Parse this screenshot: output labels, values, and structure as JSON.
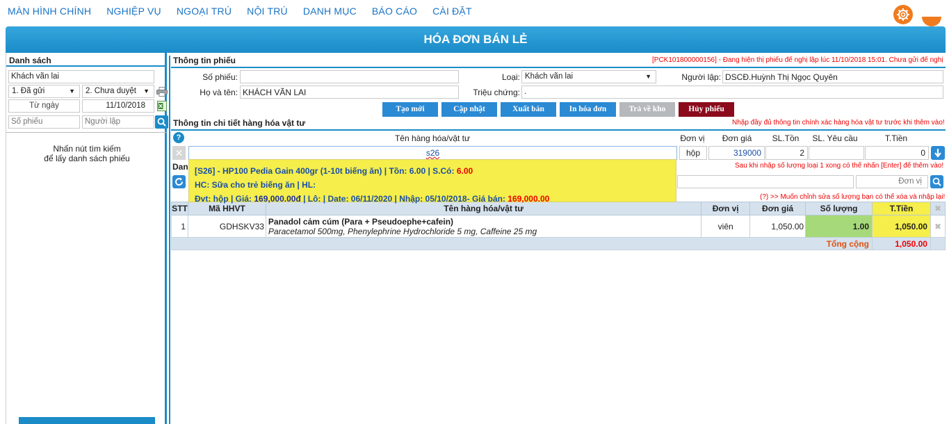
{
  "nav": {
    "items": [
      "MÀN HÌNH CHÍNH",
      "NGHIỆP VỤ",
      "NGOẠI TRÚ",
      "NỘI TRÚ",
      "DANH MỤC",
      "BÁO CÁO",
      "CÀI ĐẶT"
    ],
    "settings_icon": "gear-icon"
  },
  "page_title": "HÓA ĐƠN BÁN LẺ",
  "list_panel": {
    "title": "Danh sách",
    "customer": "Khách vãn lai",
    "status_sent": "1. Đã gửi",
    "status_approval": "2. Chưa duyệt",
    "from_date_label": "Từ ngày",
    "from_date": "11/10/2018",
    "receipt_no_placeholder": "Số phiếu",
    "creator_placeholder": "Người lập",
    "hint_line1": "Nhấn nút tìm kiếm",
    "hint_line2": "để lấy danh sách phiếu"
  },
  "receipt_info": {
    "title": "Thông tin phiếu",
    "status_note": "[PCK101800000156] - Đang hiện thị phiếu để nghị lập lúc 11/10/2018 15:01. Chưa gửi để nghị",
    "receipt_no_label": "Số phiếu:",
    "receipt_no": "",
    "type_label": "Loại:",
    "type": "Khách vãn lai",
    "creator_label": "Người lập:",
    "creator": "DSCĐ.Huỳnh Thị Ngọc Quyên",
    "fullname_label": "Họ và tên:",
    "fullname": "KHÁCH VÃN LAI",
    "symptoms_label": "Triệu chứng:",
    "symptoms": "."
  },
  "actions": {
    "create": "Tạo mới",
    "update": "Cập nhật",
    "sell": "Xuất bán",
    "print": "In hóa đơn",
    "return": "Trả về kho",
    "cancel": "Hủy phiếu"
  },
  "detail": {
    "title": "Thông tin chi tiết hàng hóa vật tư",
    "note": "Nhập đầy đủ thông tin chính xác hàng hóa vật tư trước khi thêm vào!",
    "col_name": "Tên hàng hóa/vật tư",
    "col_unit": "Đơn vị",
    "col_price": "Đơn giá",
    "col_stock": "SL.Tồn",
    "col_request": "SL. Yêu cầu",
    "col_total": "T.Tiền",
    "search_value": "s26",
    "unit": "hộp",
    "price": "319000",
    "stock": "2",
    "request_qty": "",
    "total": "0",
    "enter_note": "Sau khi nhập số lượng loại 1 xong có thể nhấn [Enter] để thêm vào!",
    "list_label": "Danh",
    "unit_placeholder": "Đơn vị",
    "edit_note": "(?) >> Muốn chỉnh sửa số lượng bạn có thể xóa và nhập lại!"
  },
  "suggestion": {
    "code": "[S26]",
    "name": " - HP100 Pedia Gain 400gr (1-10t biếng ăn) | Tồn: 6.00 | S.Có: ",
    "available": "6.00",
    "line2": "HC: Sữa cho trẻ biếng ăn | HL:",
    "line3_prefix": "Đvt: hộp | Giá: ",
    "price": "169,000.00đ",
    "line3_mid": " | Lô: | Date: 06/11/2020 | Nhập: 05/10/2018- Giá bán: ",
    "sale_price": "169,000.00"
  },
  "table": {
    "headers": [
      "STT",
      "Mã HHVT",
      "Tên hàng hóa/vật tư",
      "Đơn vị",
      "Đơn giá",
      "Số lượng",
      "T.Tiền"
    ],
    "rows": [
      {
        "stt": "1",
        "code": "GDHSKV33",
        "name": "Panadol cảm cúm (Para + Pseudoephe+cafein)",
        "ingredients": "Paracetamol 500mg, Phenylephrine Hydrochloride 5 mg, Caffeine 25 mg",
        "unit": "viên",
        "price": "1,050.00",
        "qty": "1.00",
        "amount": "1,050.00"
      }
    ],
    "total_label": "Tổng cộng",
    "total_value": "1,050.00"
  },
  "colors": {
    "brand_blue": "#1b8bc8",
    "nav_text": "#1a73c6",
    "highlight_yellow": "#f5ee4b",
    "qty_green": "#a6d97a",
    "cancel_red": "#8b0b1c",
    "gear_orange": "#f07b1e"
  }
}
